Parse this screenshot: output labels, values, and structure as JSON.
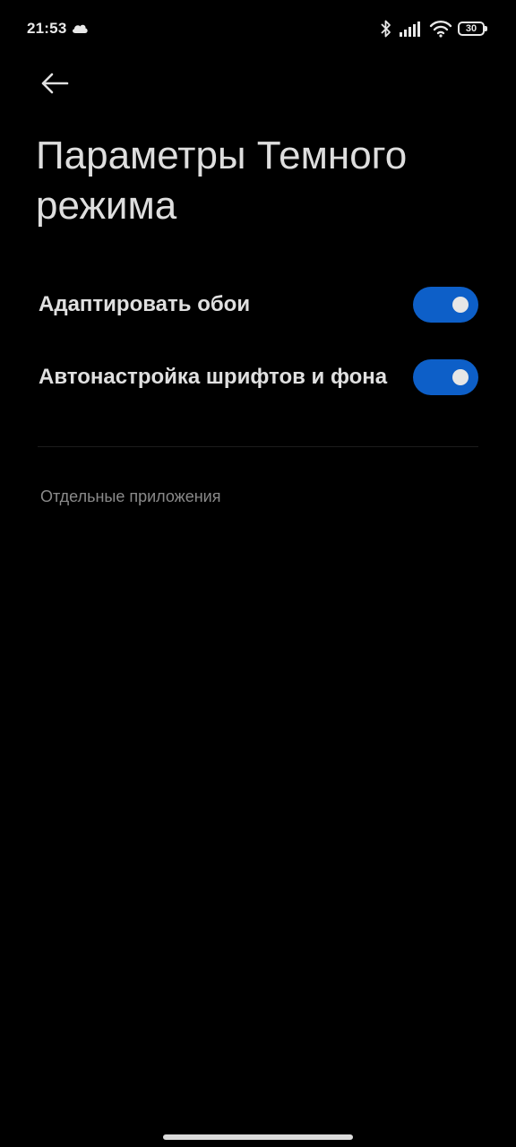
{
  "status_bar": {
    "time": "21:53",
    "battery": "30",
    "icons": [
      "cloud-icon",
      "bluetooth-icon",
      "signal-icon",
      "wifi-icon",
      "battery-icon"
    ]
  },
  "header": {
    "back_icon": "back-arrow-icon",
    "title": "Параметры Темного режима"
  },
  "settings": [
    {
      "label": "Адаптировать обои",
      "enabled": true
    },
    {
      "label": "Автонастройка шрифтов и фона",
      "enabled": true
    }
  ],
  "section": {
    "title": "Отдельные приложения"
  },
  "colors": {
    "background": "#000000",
    "toggle_on": "#0d5fc8",
    "text": "#e0e0e0",
    "secondary_text": "#8a8a8a"
  }
}
